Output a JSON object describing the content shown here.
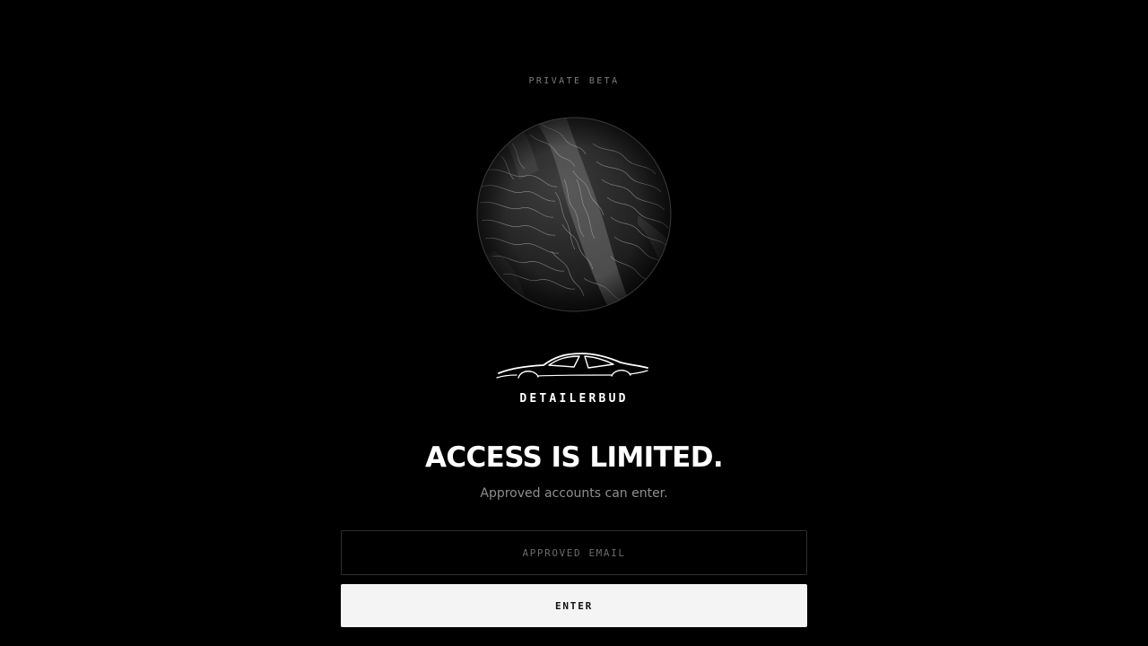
{
  "header": {
    "badge": "PRIVATE BETA"
  },
  "brand": {
    "name": "DETAILERBUD",
    "logo_icon": "sports-car-outline-icon",
    "globe_icon": "topographic-globe-icon"
  },
  "hero": {
    "headline": "ACCESS IS LIMITED.",
    "subtext": "Approved accounts can enter."
  },
  "form": {
    "email": {
      "value": "",
      "placeholder": "APPROVED EMAIL"
    },
    "submit_label": "ENTER"
  },
  "colors": {
    "background": "#000000",
    "text_primary": "#ffffff",
    "text_muted": "#8e8e8e",
    "button_background": "#f4f4f4",
    "button_text": "#111111",
    "input_border": "#2e2e2e"
  }
}
